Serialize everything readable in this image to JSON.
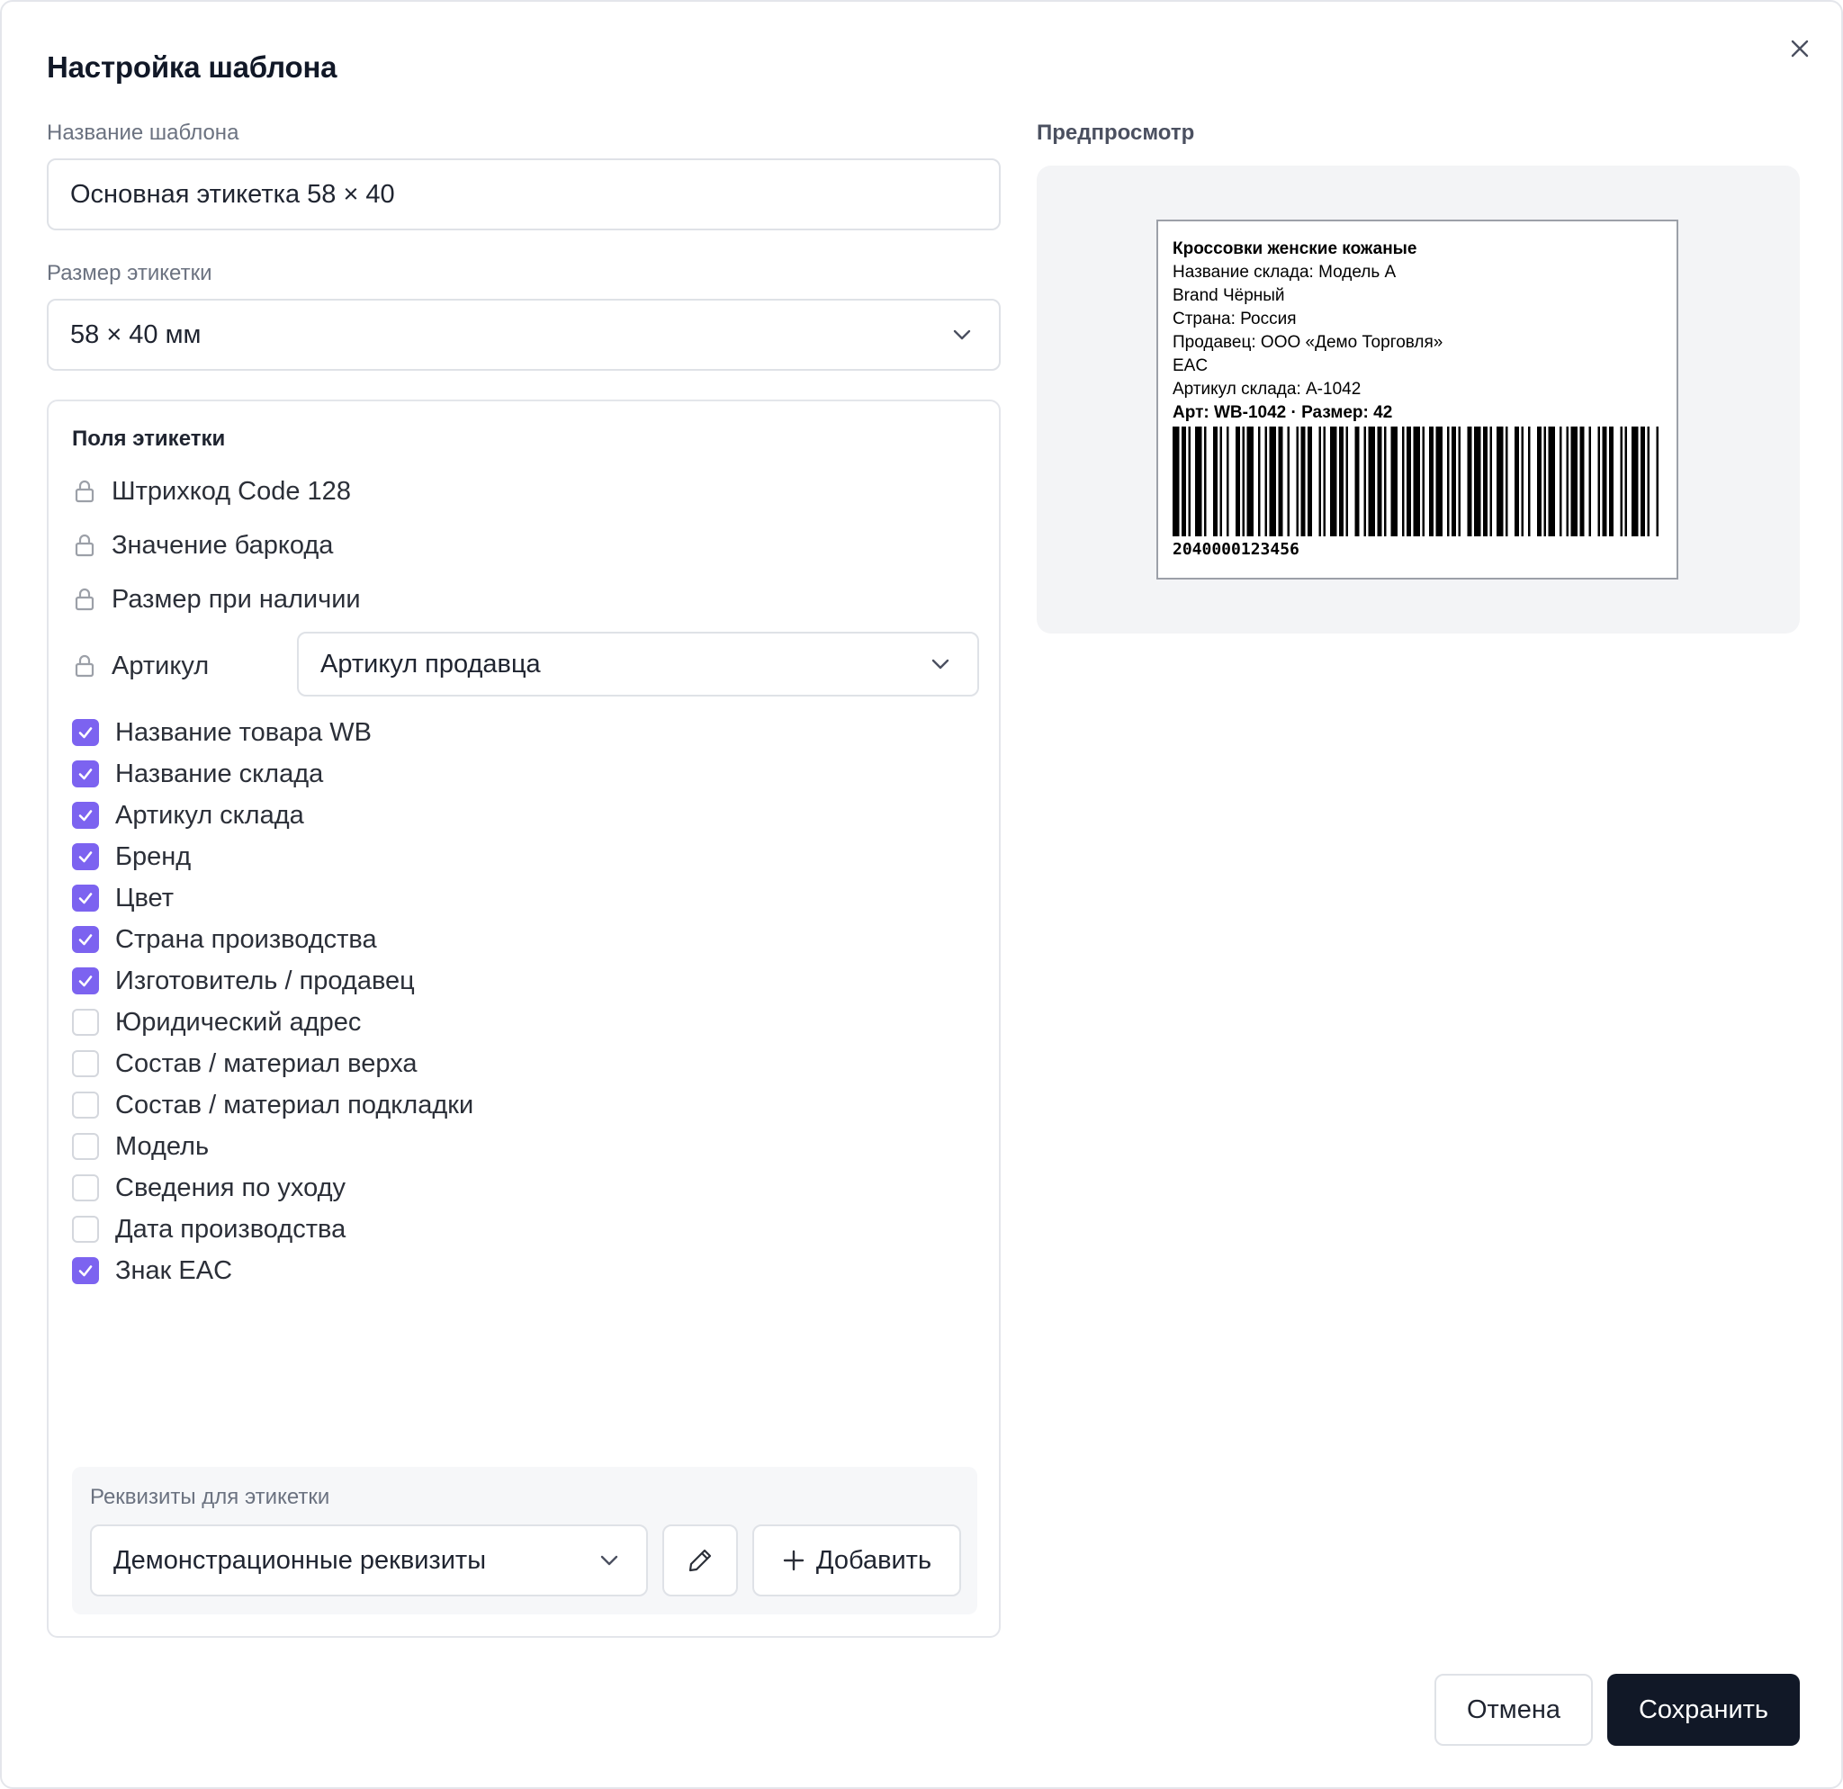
{
  "dialog": {
    "title": "Настройка шаблона",
    "close_icon": "close-icon"
  },
  "template_name": {
    "label": "Название шаблона",
    "value": "Основная этикетка 58 × 40"
  },
  "label_size": {
    "label": "Размер этикетки",
    "value": "58 × 40 мм"
  },
  "fields": {
    "title": "Поля этикетки",
    "locked": [
      {
        "label": "Штрихкод Code 128"
      },
      {
        "label": "Значение баркода"
      },
      {
        "label": "Размер при наличии"
      },
      {
        "label": "Артикул"
      }
    ],
    "article_select": {
      "value": "Артикул продавца"
    },
    "optional": [
      {
        "label": "Название товара WB",
        "checked": true
      },
      {
        "label": "Название склада",
        "checked": true
      },
      {
        "label": "Артикул склада",
        "checked": true
      },
      {
        "label": "Бренд",
        "checked": true
      },
      {
        "label": "Цвет",
        "checked": true
      },
      {
        "label": "Страна производства",
        "checked": true
      },
      {
        "label": "Изготовитель / продавец",
        "checked": true
      },
      {
        "label": "Юридический адрес",
        "checked": false
      },
      {
        "label": "Состав / материал верха",
        "checked": false
      },
      {
        "label": "Состав / материал подкладки",
        "checked": false
      },
      {
        "label": "Модель",
        "checked": false
      },
      {
        "label": "Сведения по уходу",
        "checked": false
      },
      {
        "label": "Дата производства",
        "checked": false
      },
      {
        "label": "Знак EAC",
        "checked": true
      }
    ]
  },
  "requisites": {
    "label": "Реквизиты для этикетки",
    "value": "Демонстрационные реквизиты",
    "add_label": "Добавить"
  },
  "preview": {
    "label": "Предпросмотр",
    "lines": [
      {
        "text": "Кроссовки женские кожаные",
        "bold": true
      },
      {
        "text": "Название склада: Модель А",
        "bold": false
      },
      {
        "text": "Brand   Чёрный",
        "bold": false
      },
      {
        "text": "Страна: Россия",
        "bold": false
      },
      {
        "text": "Продавец: ООО «Демо Торговля»",
        "bold": false
      },
      {
        "text": "EAC",
        "bold": false
      },
      {
        "text": "Артикул склада: A-1042",
        "bold": false
      },
      {
        "text": "Арт: WB-1042 · Размер: 42",
        "bold": true
      }
    ],
    "barcode_value": "2040000123456"
  },
  "footer": {
    "cancel_label": "Отмена",
    "save_label": "Сохранить"
  },
  "colors": {
    "accent": "#7c63f0",
    "primary_button": "#111827"
  }
}
